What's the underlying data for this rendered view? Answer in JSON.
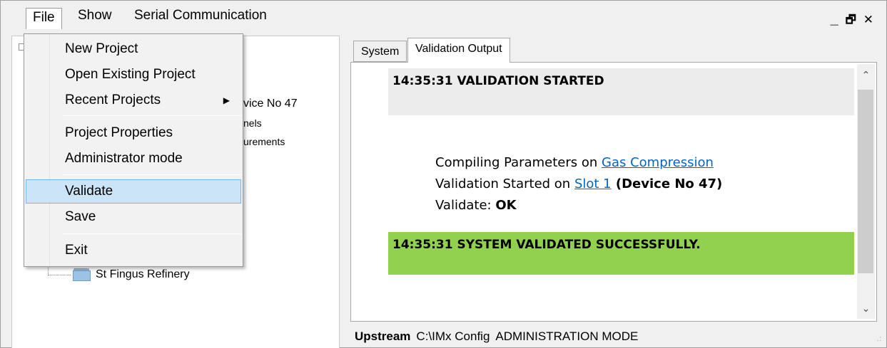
{
  "menubar": {
    "items": [
      "File",
      "Show",
      "Serial Communication"
    ],
    "window_controls": {
      "minimize": "_",
      "restore": "🗗",
      "close": "✕"
    }
  },
  "file_menu": {
    "items": [
      {
        "label": "New Project"
      },
      {
        "label": "Open Existing Project"
      },
      {
        "label": "Recent Projects",
        "submenu": true
      },
      {
        "label": "Project Properties"
      },
      {
        "label": "Administrator mode"
      },
      {
        "label": "Validate",
        "selected": true
      },
      {
        "label": "Save"
      },
      {
        "label": "Exit"
      }
    ]
  },
  "tree": {
    "visible_fragments": [
      "vice No 47",
      "nels",
      "urements"
    ],
    "refinery_node": "St Fingus Refinery"
  },
  "tabs": [
    {
      "label": "System",
      "active": false
    },
    {
      "label": "Validation Output",
      "active": true
    }
  ],
  "output": {
    "started": "14:35:31 VALIDATION STARTED",
    "line1_prefix": "Compiling Parameters on ",
    "line1_link": "Gas Compression",
    "line2_prefix": "Validation Started on ",
    "line2_link": "Slot 1",
    "line2_suffix": " (Device No 47)",
    "line3_prefix": "Validate: ",
    "line3_value": "OK",
    "success": "14:35:31 SYSTEM VALIDATED SUCCESSFULLY."
  },
  "statusbar": {
    "project": "Upstream",
    "path": "C:\\IMx Config",
    "mode": "ADMINISTRATION MODE"
  },
  "colors": {
    "success_band": "#92d050",
    "started_band": "#ececec",
    "link": "#0563c1",
    "selected_item": "#cce4f7"
  }
}
